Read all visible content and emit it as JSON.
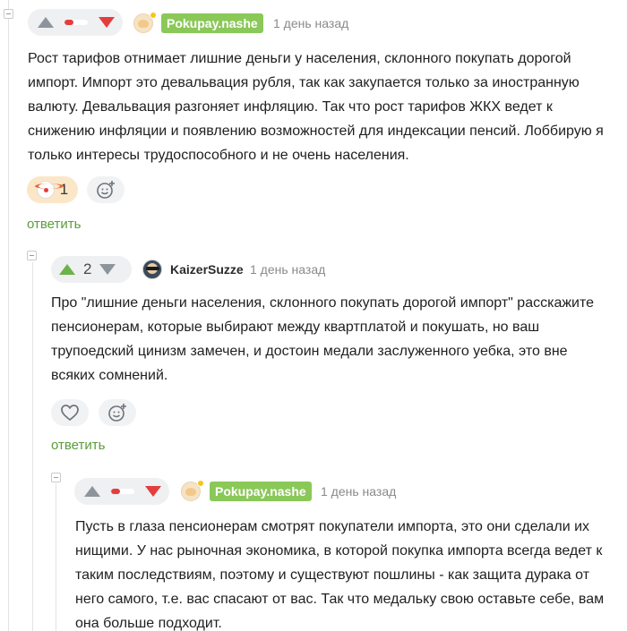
{
  "comments": [
    {
      "id": "c1",
      "author": "Pokupay.nashe",
      "time": "1 день назад",
      "text": "Рост тарифов отнимает лишние деньги у населения, склонного покупать дорогой импорт. Импорт это девальвация рубля, так как закупается только за иностранную валюту. Девальвация разгоняет инфляцию. Так что рост тарифов ЖКХ ведет к снижению инфляции и появлению возможностей для индексации пенсий. Лоббирую я только интересы трудоспособного и не очень населения.",
      "vote_ratio_negative": 0.4,
      "reactions": [
        {
          "icon": "clown-emoji-icon",
          "count": "1"
        },
        {
          "icon": "add-reaction-icon"
        }
      ],
      "reply_label": "ответить"
    },
    {
      "id": "c2",
      "author": "KaizerSuzze",
      "time": "1 день назад",
      "rating": "2",
      "text": "Про \"лишние деньги населения, склонного покупать дорогой импорт\" расскажите пенсионерам, которые выбирают между квартплатой и покушать, но ваш трупоедский цинизм замечен, и достоин медали заслуженного уебка, это вне всяких сомнений.",
      "reactions": [
        {
          "icon": "heart-icon"
        },
        {
          "icon": "add-reaction-icon"
        }
      ],
      "reply_label": "ответить"
    },
    {
      "id": "c3",
      "author": "Pokupay.nashe",
      "time": "1 день назад",
      "text": "Пусть в глаза пенсионерам смотрят покупатели импорта, это они сделали их нищими. У нас рыночная экономика, в которой покупка импорта всегда ведет к таким последствиям, поэтому и существуют пошлины - как защита дурака от него самого, т.е. вас спасают от вас. Так что медальку свою оставьте себе, вам она больше подходит.",
      "vote_ratio_negative": 0.4
    }
  ],
  "colors": {
    "author_tag_bg": "#8ac858",
    "upvote_active": "#6bb34b",
    "downvote": "#e43d3d",
    "reply_link": "#5a9c3a"
  }
}
